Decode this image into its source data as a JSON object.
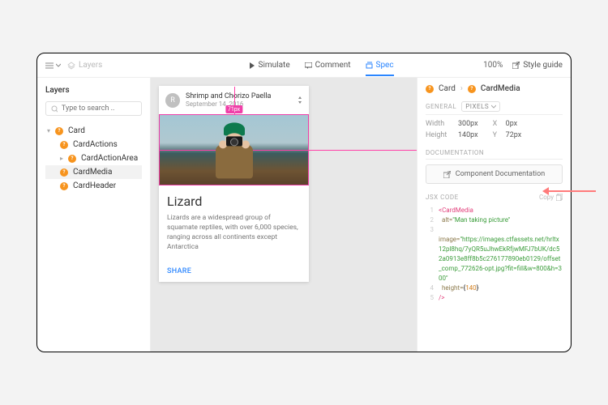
{
  "topbar": {
    "layers_label": "Layers",
    "simulate": "Simulate",
    "comment": "Comment",
    "spec": "Spec",
    "zoom": "100%",
    "style_guide": "Style guide"
  },
  "sidebar": {
    "title": "Layers",
    "search_placeholder": "Type to search ..",
    "tree": {
      "root": "Card",
      "children": [
        "CardActions",
        "CardActionArea",
        "CardMedia",
        "CardHeader"
      ]
    }
  },
  "card": {
    "avatar_letter": "R",
    "title": "Shrimp and Chorizo Paella",
    "subtitle": "September 14, 2016",
    "measure_label": "71px",
    "body_title": "Lizard",
    "body_text": "Lizards are a widespread group of squamate reptiles, with over 6,000 species, ranging across all continents except Antarctica",
    "action": "SHARE"
  },
  "inspector": {
    "breadcrumb_parent": "Card",
    "breadcrumb_current": "CardMedia",
    "general_label": "GENERAL",
    "units": "PIXELS",
    "width_label": "Width",
    "width_val": "300px",
    "height_label": "Height",
    "height_val": "140px",
    "x_label": "X",
    "x_val": "0px",
    "y_label": "Y",
    "y_val": "72px",
    "doc_label": "DOCUMENTATION",
    "doc_button": "Component Documentation",
    "jsx_label": "JSX CODE",
    "copy_label": "Copy",
    "code": {
      "tag": "CardMedia",
      "alt_attr": "alt=",
      "alt_val": "\"Man taking picture\"",
      "image_attr": "image=",
      "image_val": "\"https://images.ctfassets.net/hrltx12pl8hq/7yQR5uJhwEkRfjwMFJ7bUK/dc52a0913e8ff8b5c276177890eb0129/offset_comp_772626-opt.jpg?fit=fill&w=800&h=300\"",
      "height_attr": "height=",
      "height_val": "140"
    }
  }
}
